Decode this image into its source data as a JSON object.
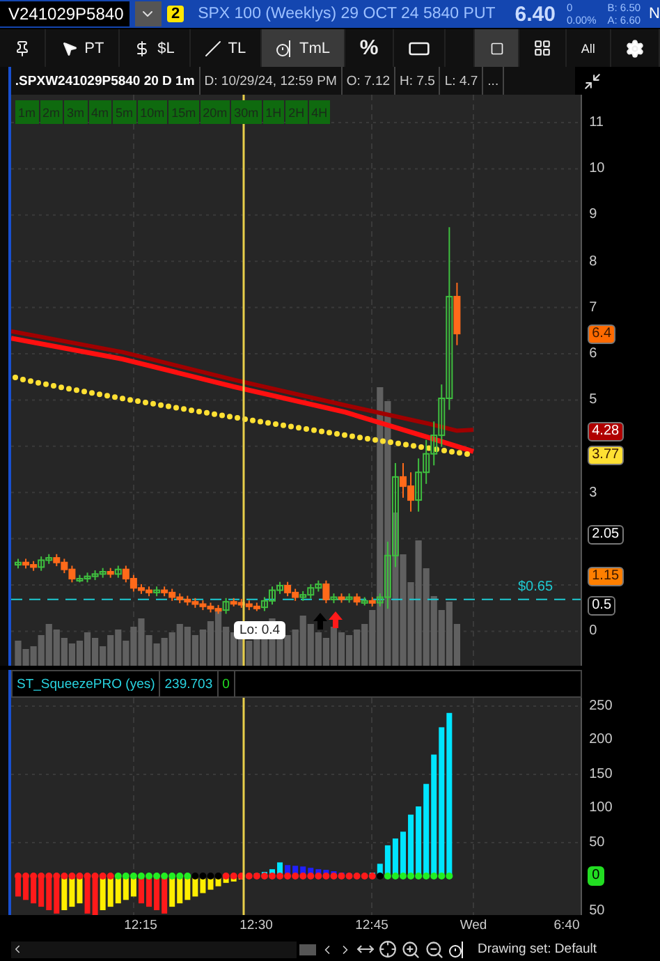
{
  "quote_bar": {
    "symbol": "V241029P5840",
    "link_badge": "2",
    "description": "SPX 100 (Weeklys) 29 OCT 24 5840 PUT",
    "last": "6.40",
    "change": "0",
    "change_percent": "0.00%",
    "bid": "B: 6.50",
    "ask": "A: 6.60",
    "edge_label": "N"
  },
  "drawing_tools": [
    {
      "kind": "pin",
      "selected": false
    },
    {
      "kind": "pointer",
      "label": "PT",
      "selected": false
    },
    {
      "kind": "price",
      "label": "$L",
      "selected": false
    },
    {
      "kind": "trendline",
      "label": "TL",
      "selected": false
    },
    {
      "kind": "timeline",
      "label": "TmL",
      "selected": true
    },
    {
      "kind": "text",
      "label": "%",
      "selected": false
    },
    {
      "kind": "rectangle",
      "selected": false
    }
  ],
  "layout_tools": [
    {
      "kind": "single",
      "selected": true
    },
    {
      "kind": "grid",
      "selected": false
    },
    {
      "kind": "text",
      "label": "All",
      "selected": false
    },
    {
      "kind": "settings",
      "selected": false
    }
  ],
  "chart_header": {
    "title": ".SPXW241029P5840 20 D 1m",
    "date": "D: 10/29/24, 12:59 PM",
    "open": "O: 7.12",
    "high": "H: 7.5",
    "low": "L: 4.7",
    "more": "..."
  },
  "timeframes": [
    "1m",
    "2m",
    "3m",
    "4m",
    "5m",
    "10m",
    "15m",
    "20m",
    "30m",
    "1H",
    "2H",
    "4H"
  ],
  "price_axis": {
    "ticks": [
      "11",
      "10",
      "9",
      "8",
      "7",
      "6",
      "5",
      "3",
      "0"
    ],
    "badges": [
      {
        "text": "6.4",
        "color": "#ff6a00"
      },
      {
        "text": "4.28",
        "color": "#b00000"
      },
      {
        "text": "3.77",
        "color": "#ffe033"
      },
      {
        "text": "2.05",
        "color": "#000000"
      },
      {
        "text": "1.15",
        "color": "#ff7f00"
      },
      {
        "text": "0.5",
        "color": "#000000"
      }
    ]
  },
  "price_line_label": "$0.65",
  "low_label": "Lo: 0.4",
  "indicator": {
    "name": "ST_SqueezePRO (yes)",
    "value": "239.703",
    "signal": "0",
    "ticks": [
      "250",
      "200",
      "150",
      "100",
      "50",
      "50"
    ],
    "badge": "0"
  },
  "time_axis": [
    "12:15",
    "12:30",
    "12:45",
    "Wed",
    "6:40"
  ],
  "status_bar": {
    "drawing_set": "Drawing set: Default"
  }
}
